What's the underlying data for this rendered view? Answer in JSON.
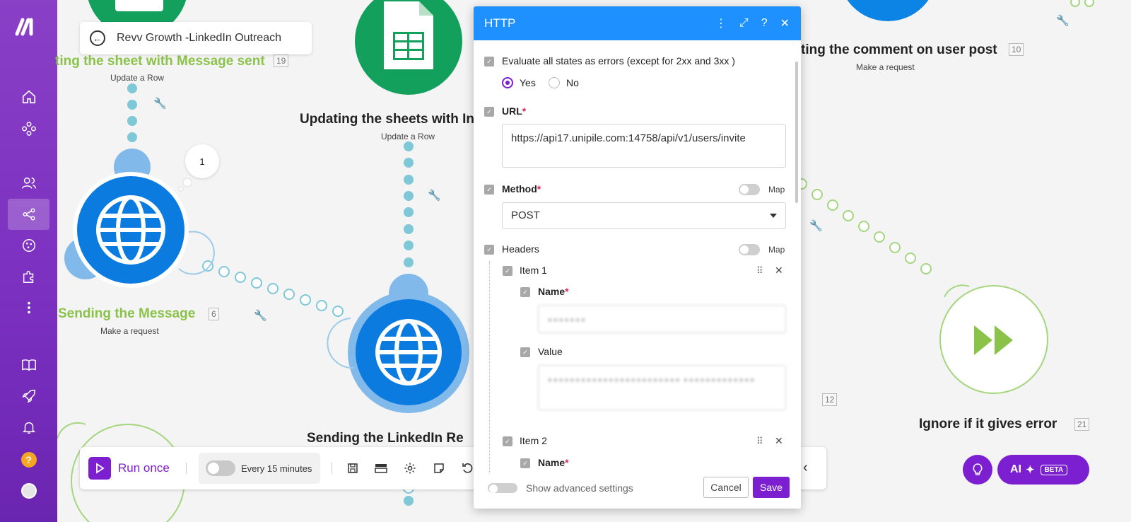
{
  "app": {
    "accent": "#7b1fd1",
    "sidebar_color": "#7a2fbf",
    "header_color": "#1e90ff"
  },
  "sidebar": {
    "logo_icon": "make-logo-icon",
    "items": [
      {
        "icon": "home-icon"
      },
      {
        "icon": "connections-icon"
      },
      {
        "icon": "team-icon"
      },
      {
        "icon": "scenarios-share-icon",
        "active": true
      },
      {
        "icon": "templates-icon"
      },
      {
        "icon": "apps-puzzle-icon"
      },
      {
        "icon": "more-dots-icon"
      },
      {
        "icon": "docs-book-icon"
      },
      {
        "icon": "rocket-icon"
      },
      {
        "icon": "notifications-bell-icon"
      },
      {
        "icon": "help-icon",
        "label": "?"
      },
      {
        "icon": "avatar"
      }
    ]
  },
  "breadcrumb": {
    "title": "Revv Growth -LinkedIn Outreach"
  },
  "canvas": {
    "nodes": [
      {
        "title": "ting the sheet with Message sent",
        "sub": "Update a Row",
        "id": "19"
      },
      {
        "title": "Updating the sheets with Inv",
        "sub": "Update a Row"
      },
      {
        "title": "ting the comment on user post",
        "sub": "Make a request",
        "id": "10"
      },
      {
        "title": "Sending the Message",
        "sub": "Make a request",
        "id": "6"
      },
      {
        "title": "Sending the LinkedIn Re"
      },
      {
        "title": "Ignore if it gives error",
        "id": "21"
      },
      {
        "id": "12"
      }
    ],
    "bubble_count": "1"
  },
  "toolbar": {
    "run_label": "Run once",
    "schedule_label": "Every 15 minutes",
    "icons": [
      "save-icon",
      "explain-flow-icon",
      "settings-gear-icon",
      "notes-icon",
      "undo-icon"
    ]
  },
  "assist": {
    "ai_label": "AI",
    "beta_label": "BETA"
  },
  "modal": {
    "title": "HTTP",
    "evaluate_label": "Evaluate all states as errors (except for 2xx and 3xx )",
    "yes_label": "Yes",
    "no_label": "No",
    "url_label": "URL",
    "url_value": "https://api17.unipile.com:14758/api/v1/users/invite",
    "required_mark": "*",
    "method_label": "Method",
    "method_value": "POST",
    "map_label": "Map",
    "headers_label": "Headers",
    "item1_label": "Item 1",
    "name_label": "Name",
    "value_label": "Value",
    "item2_label": "Item 2",
    "advanced_label": "Show advanced settings",
    "cancel_label": "Cancel",
    "save_label": "Save"
  }
}
